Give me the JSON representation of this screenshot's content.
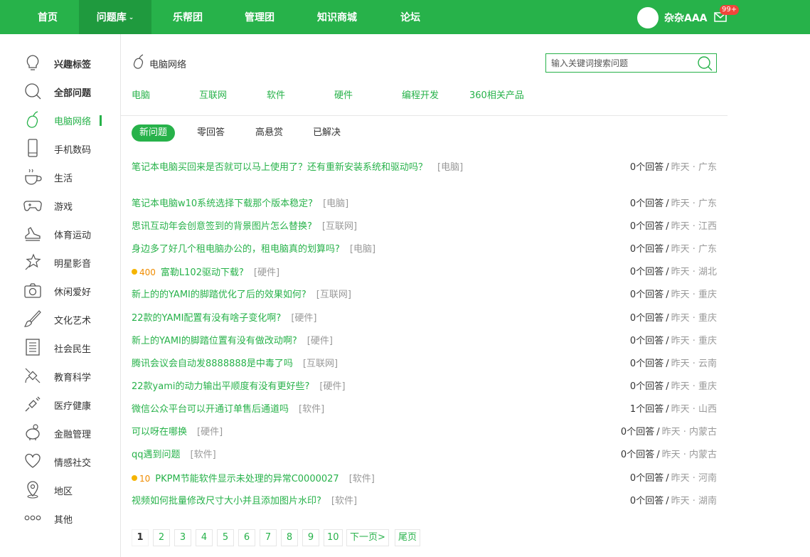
{
  "nav": {
    "items": [
      "首页",
      "问题库",
      "乐帮团",
      "管理团",
      "知识商城",
      "论坛"
    ],
    "active_caret": "⌄"
  },
  "user": {
    "name": "杂杂AAA",
    "badge": "99+"
  },
  "sidebar": {
    "items": [
      "兴趣标签",
      "全部问题",
      "电脑网络",
      "手机数码",
      "生活",
      "游戏",
      "体育运动",
      "明星影音",
      "休闲爱好",
      "文化艺术",
      "社会民生",
      "教育科学",
      "医疗健康",
      "金融管理",
      "情感社交",
      "地区",
      "其他"
    ]
  },
  "main": {
    "category": "电脑网络",
    "search_placeholder": "输入关键词搜索问题",
    "subcategories": [
      "电脑",
      "互联网",
      "软件",
      "硬件",
      "编程开发",
      "360相关产品"
    ],
    "filters": [
      "新问题",
      "零回答",
      "高悬赏",
      "已解决"
    ]
  },
  "questions": [
    {
      "title": "笔记本电脑买回来是否就可以马上使用了？还有重新安装系统和驱动吗？",
      "tag": "[电脑]",
      "reward": "",
      "count": "0个回答",
      "sep": "/",
      "meta": "昨天 · 广东"
    },
    {
      "title": "笔记本电脑w10系统选择下载那个版本稳定?",
      "tag": "[电脑]",
      "reward": "",
      "count": "0个回答",
      "sep": "/",
      "meta": "昨天 · 广东"
    },
    {
      "title": "思讯互动年会创意签到的背景图片怎么替换?",
      "tag": "[互联网]",
      "reward": "",
      "count": "0个回答",
      "sep": "/",
      "meta": "昨天 · 江西"
    },
    {
      "title": "身边多了好几个租电脑办公的，租电脑真的划算吗?",
      "tag": "[电脑]",
      "reward": "",
      "count": "0个回答",
      "sep": "/",
      "meta": "昨天 · 广东"
    },
    {
      "title": "富勒L102驱动下载?",
      "tag": "[硬件]",
      "reward": "400",
      "count": "0个回答",
      "sep": "/",
      "meta": "昨天 · 湖北"
    },
    {
      "title": "新上的的YAMI的脚踏优化了后的效果如何?",
      "tag": "[互联网]",
      "reward": "",
      "count": "0个回答",
      "sep": "/",
      "meta": "昨天 · 重庆"
    },
    {
      "title": "22款的YAMI配置有没有啥子变化啊?",
      "tag": "[硬件]",
      "reward": "",
      "count": "0个回答",
      "sep": "/",
      "meta": "昨天 · 重庆"
    },
    {
      "title": "新上的YAMI的脚踏位置有没有做改动啊?",
      "tag": "[硬件]",
      "reward": "",
      "count": "0个回答",
      "sep": "/",
      "meta": "昨天 · 重庆"
    },
    {
      "title": "腾讯会议会自动发8888888是中毒了吗",
      "tag": "[互联网]",
      "reward": "",
      "count": "0个回答",
      "sep": "/",
      "meta": "昨天 · 云南"
    },
    {
      "title": "22款yami的动力输出平顺度有没有更好些?",
      "tag": "[硬件]",
      "reward": "",
      "count": "0个回答",
      "sep": "/",
      "meta": "昨天 · 重庆"
    },
    {
      "title": "微信公众平台可以开通订单售后通道吗",
      "tag": "[软件]",
      "reward": "",
      "count": "1个回答",
      "sep": "/",
      "meta": "昨天 · 山西"
    },
    {
      "title": "可以呀在哪换",
      "tag": "[硬件]",
      "reward": "",
      "count": "0个回答",
      "sep": "/",
      "meta": "昨天 · 内蒙古"
    },
    {
      "title": "qq遇到问题",
      "tag": "[软件]",
      "reward": "",
      "count": "0个回答",
      "sep": "/",
      "meta": "昨天 · 内蒙古"
    },
    {
      "title": "PKPM节能软件显示未处理的异常C0000027",
      "tag": "[软件]",
      "reward": "10",
      "count": "0个回答",
      "sep": "/",
      "meta": "昨天 · 河南"
    },
    {
      "title": "视频如何批量修改尺寸大小并且添加图片水印?",
      "tag": "[软件]",
      "reward": "",
      "count": "0个回答",
      "sep": "/",
      "meta": "昨天 · 湖南"
    }
  ],
  "pagination": {
    "pages": [
      "1",
      "2",
      "3",
      "4",
      "5",
      "6",
      "7",
      "8",
      "9",
      "10"
    ],
    "next": "下一页>",
    "last": "尾页",
    "current": "1"
  },
  "colors": {
    "brand": "#27b24a",
    "brand_dark": "#1f9a3e",
    "badge": "#f0453a",
    "reward": "#f08c00"
  }
}
